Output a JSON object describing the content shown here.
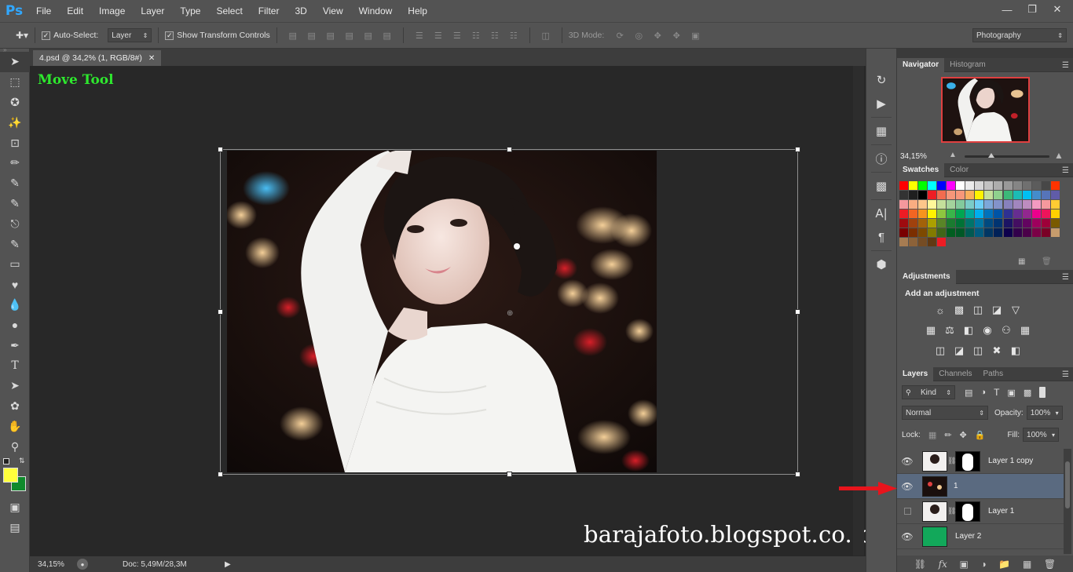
{
  "app": {
    "logo": "Ps",
    "menus": [
      "File",
      "Edit",
      "Image",
      "Layer",
      "Type",
      "Select",
      "Filter",
      "3D",
      "View",
      "Window",
      "Help"
    ]
  },
  "options": {
    "auto_select_label": "Auto-Select:",
    "auto_select_checked": true,
    "target_value": "Layer",
    "show_transform_label": "Show Transform Controls",
    "show_transform_checked": true,
    "mode_label": "3D Mode:",
    "workspace": "Photography"
  },
  "document": {
    "tab_title": "4.psd @ 34,2% (1, RGB/8#)",
    "tool_hint": "Move Tool",
    "watermark": "barajafoto.blogspot.co.id"
  },
  "status": {
    "zoom": "34,15%",
    "doc_info": "Doc: 5,49M/28,3M"
  },
  "navigator": {
    "tabs": [
      "Navigator",
      "Histogram"
    ],
    "zoom": "34,15%"
  },
  "swatches": {
    "tabs": [
      "Swatches",
      "Color"
    ],
    "colors": [
      "#ff0000",
      "#ffff00",
      "#00ff00",
      "#00ffff",
      "#0000ff",
      "#ff00ff",
      "#ffffff",
      "#ebebeb",
      "#d6d6d6",
      "#c2c2c2",
      "#adadad",
      "#999999",
      "#858585",
      "#707070",
      "#5c5c5c",
      "#474747",
      "#ff3300",
      "#333333",
      "#1f1f1f",
      "#000000",
      "#ee1d24",
      "#f26c4f",
      "#f69679",
      "#f7977a",
      "#fbaf5d",
      "#fff200",
      "#c4df9b",
      "#8fd18d",
      "#3cb878",
      "#1cbbb4",
      "#00bff3",
      "#448ccb",
      "#5674b9",
      "#605ca8",
      "#f5989d",
      "#f9ad81",
      "#fdc68a",
      "#fff799",
      "#c4df9b",
      "#a3d39c",
      "#82ca9c",
      "#7accc8",
      "#6dcff6",
      "#7da7d9",
      "#8393ca",
      "#8781bd",
      "#a186be",
      "#bd8cbf",
      "#f49ac1",
      "#f5989d",
      "#ffcc33",
      "#ed1c24",
      "#f26522",
      "#f7941d",
      "#fff200",
      "#8dc63f",
      "#39b54a",
      "#00a651",
      "#00a99d",
      "#00aeef",
      "#0072bc",
      "#0054a6",
      "#2e3192",
      "#662d91",
      "#92278f",
      "#ec008c",
      "#ed145b",
      "#ffd000",
      "#9e0b0f",
      "#a0410d",
      "#a36209",
      "#aba000",
      "#598527",
      "#1a7b30",
      "#007236",
      "#00746b",
      "#0076a3",
      "#004a80",
      "#003471",
      "#1b1464",
      "#440e62",
      "#630460",
      "#9e005d",
      "#9e0039",
      "#7a5a00",
      "#790000",
      "#7b2e00",
      "#7d4900",
      "#827b00",
      "#406618",
      "#005e20",
      "#005826",
      "#005952",
      "#005b7f",
      "#003663",
      "#002157",
      "#0d004c",
      "#32004b",
      "#4b0049",
      "#7b0046",
      "#7a0026",
      "#c69c6d",
      "#a67c52",
      "#8c6239",
      "#754c24",
      "#603913",
      "#ed1c24"
    ]
  },
  "adjustments": {
    "tab": "Adjustments",
    "heading": "Add an adjustment"
  },
  "layers": {
    "tabs": [
      "Layers",
      "Channels",
      "Paths"
    ],
    "filter_kind": "Kind",
    "blend_mode": "Normal",
    "opacity_label": "Opacity:",
    "opacity": "100%",
    "lock_label": "Lock:",
    "fill_label": "Fill:",
    "fill": "100%",
    "items": [
      {
        "name": "Layer 1 copy",
        "visible": true
      },
      {
        "name": "1",
        "visible": true,
        "selected": true
      },
      {
        "name": "Layer 1",
        "visible": false
      },
      {
        "name": "Layer 2",
        "visible": true
      }
    ]
  }
}
